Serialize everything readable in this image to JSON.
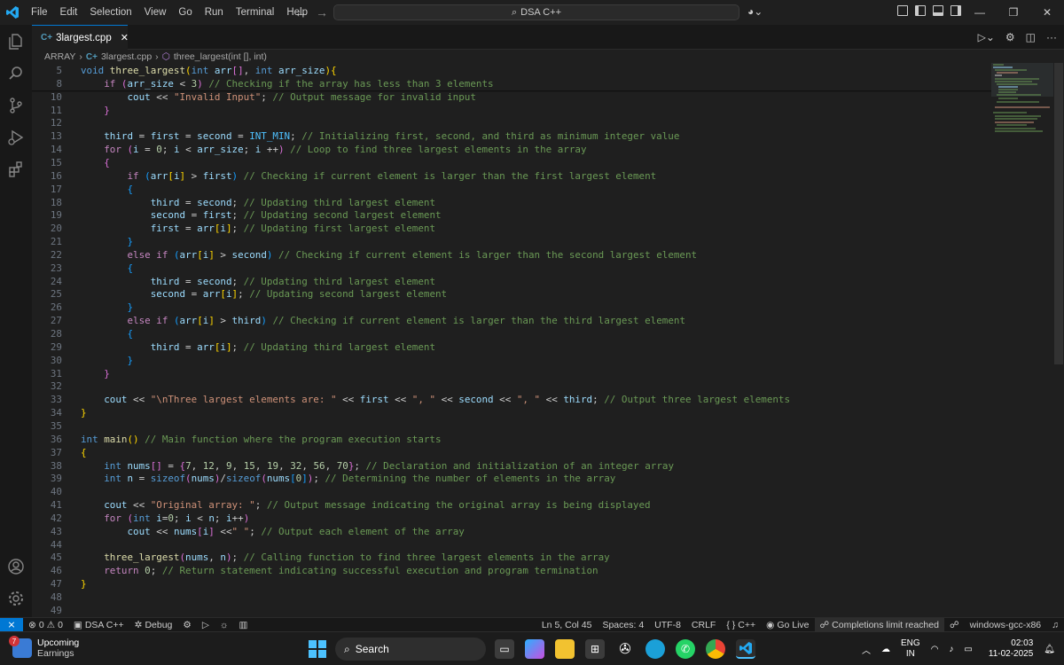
{
  "menu": [
    "File",
    "Edit",
    "Selection",
    "View",
    "Go",
    "Run",
    "Terminal",
    "Help"
  ],
  "command_center": {
    "label": "DSA C++"
  },
  "tab": {
    "label": "3largest.cpp",
    "close": "✕"
  },
  "breadcrumb": {
    "folder": "ARRAY",
    "file": "3largest.cpp",
    "symbol": "three_largest(int [], int)"
  },
  "code_lines": [
    {
      "ln": "5",
      "html": "<span class='k'>void</span> <span class='f'>three_largest</span><span class='b1'>(</span><span class='k'>int</span> <span class='v'>arr</span><span class='b2'>[]</span>, <span class='k'>int</span> <span class='v'>arr_size</span><span class='b1'>){</span>",
      "sticky": true
    },
    {
      "ln": "8",
      "html": "    <span class='kc'>if</span> <span class='b2'>(</span><span class='v'>arr_size</span> &lt; <span class='n'>3</span><span class='b2'>)</span> <span class='c'>// Checking if the array has less than 3 elements</span>",
      "sticky": true
    },
    {
      "ln": "10",
      "html": "        <span class='v'>cout</span> &lt;&lt; <span class='s'>\"Invalid Input\"</span>; <span class='c'>// Output message for invalid input</span>"
    },
    {
      "ln": "11",
      "html": "    <span class='b2'>}</span>"
    },
    {
      "ln": "12",
      "html": ""
    },
    {
      "ln": "13",
      "html": "    <span class='v'>third</span> = <span class='v'>first</span> = <span class='v'>second</span> = <span class='mac'>INT_MIN</span>; <span class='c'>// Initializing first, second, and third as minimum integer value</span>"
    },
    {
      "ln": "14",
      "html": "    <span class='kc'>for</span> <span class='b2'>(</span><span class='v'>i</span> = <span class='n'>0</span>; <span class='v'>i</span> &lt; <span class='v'>arr_size</span>; <span class='v'>i</span> ++<span class='b2'>)</span> <span class='c'>// Loop to find three largest elements in the array</span>"
    },
    {
      "ln": "15",
      "html": "    <span class='b2'>{</span>"
    },
    {
      "ln": "16",
      "html": "        <span class='kc'>if</span> <span class='b3'>(</span><span class='v'>arr</span><span class='b1'>[</span><span class='v'>i</span><span class='b1'>]</span> &gt; <span class='v'>first</span><span class='b3'>)</span> <span class='c'>// Checking if current element is larger than the first largest element</span>"
    },
    {
      "ln": "17",
      "html": "        <span class='b3'>{</span>"
    },
    {
      "ln": "18",
      "html": "            <span class='v'>third</span> = <span class='v'>second</span>; <span class='c'>// Updating third largest element</span>"
    },
    {
      "ln": "19",
      "html": "            <span class='v'>second</span> = <span class='v'>first</span>; <span class='c'>// Updating second largest element</span>"
    },
    {
      "ln": "20",
      "html": "            <span class='v'>first</span> = <span class='v'>arr</span><span class='b1'>[</span><span class='v'>i</span><span class='b1'>]</span>; <span class='c'>// Updating first largest element</span>"
    },
    {
      "ln": "21",
      "html": "        <span class='b3'>}</span>"
    },
    {
      "ln": "22",
      "html": "        <span class='kc'>else</span> <span class='kc'>if</span> <span class='b3'>(</span><span class='v'>arr</span><span class='b1'>[</span><span class='v'>i</span><span class='b1'>]</span> &gt; <span class='v'>second</span><span class='b3'>)</span> <span class='c'>// Checking if current element is larger than the second largest element</span>"
    },
    {
      "ln": "23",
      "html": "        <span class='b3'>{</span>"
    },
    {
      "ln": "24",
      "html": "            <span class='v'>third</span> = <span class='v'>second</span>; <span class='c'>// Updating third largest element</span>"
    },
    {
      "ln": "25",
      "html": "            <span class='v'>second</span> = <span class='v'>arr</span><span class='b1'>[</span><span class='v'>i</span><span class='b1'>]</span>; <span class='c'>// Updating second largest element</span>"
    },
    {
      "ln": "26",
      "html": "        <span class='b3'>}</span>"
    },
    {
      "ln": "27",
      "html": "        <span class='kc'>else</span> <span class='kc'>if</span> <span class='b3'>(</span><span class='v'>arr</span><span class='b1'>[</span><span class='v'>i</span><span class='b1'>]</span> &gt; <span class='v'>third</span><span class='b3'>)</span> <span class='c'>// Checking if current element is larger than the third largest element</span>"
    },
    {
      "ln": "28",
      "html": "        <span class='b3'>{</span>"
    },
    {
      "ln": "29",
      "html": "            <span class='v'>third</span> = <span class='v'>arr</span><span class='b1'>[</span><span class='v'>i</span><span class='b1'>]</span>; <span class='c'>// Updating third largest element</span>"
    },
    {
      "ln": "30",
      "html": "        <span class='b3'>}</span>"
    },
    {
      "ln": "31",
      "html": "    <span class='b2'>}</span>"
    },
    {
      "ln": "32",
      "html": ""
    },
    {
      "ln": "33",
      "html": "    <span class='v'>cout</span> &lt;&lt; <span class='s'>\"\\nThree largest elements are: \"</span> &lt;&lt; <span class='v'>first</span> &lt;&lt; <span class='s'>\", \"</span> &lt;&lt; <span class='v'>second</span> &lt;&lt; <span class='s'>\", \"</span> &lt;&lt; <span class='v'>third</span>; <span class='c'>// Output three largest elements</span>"
    },
    {
      "ln": "34",
      "html": "<span class='b1'>}</span>"
    },
    {
      "ln": "35",
      "html": ""
    },
    {
      "ln": "36",
      "html": "<span class='k'>int</span> <span class='f'>main</span><span class='b1'>()</span> <span class='c'>// Main function where the program execution starts</span>"
    },
    {
      "ln": "37",
      "html": "<span class='b1'>{</span>"
    },
    {
      "ln": "38",
      "html": "    <span class='k'>int</span> <span class='v'>nums</span><span class='b2'>[]</span> = <span class='b2'>{</span><span class='n'>7</span>, <span class='n'>12</span>, <span class='n'>9</span>, <span class='n'>15</span>, <span class='n'>19</span>, <span class='n'>32</span>, <span class='n'>56</span>, <span class='n'>70</span><span class='b2'>}</span>; <span class='c'>// Declaration and initialization of an integer array</span>"
    },
    {
      "ln": "39",
      "html": "    <span class='k'>int</span> <span class='v'>n</span> = <span class='k'>sizeof</span><span class='b2'>(</span><span class='v'>nums</span><span class='b2'>)</span>/<span class='k'>sizeof</span><span class='b2'>(</span><span class='v'>nums</span><span class='b3'>[</span><span class='n'>0</span><span class='b3'>]</span><span class='b2'>)</span>; <span class='c'>// Determining the number of elements in the array</span>"
    },
    {
      "ln": "40",
      "html": ""
    },
    {
      "ln": "41",
      "html": "    <span class='v'>cout</span> &lt;&lt; <span class='s'>\"Original array: \"</span>; <span class='c'>// Output message indicating the original array is being displayed</span>"
    },
    {
      "ln": "42",
      "html": "    <span class='kc'>for</span> <span class='b2'>(</span><span class='k'>int</span> <span class='v'>i</span>=<span class='n'>0</span>; <span class='v'>i</span> &lt; <span class='v'>n</span>; <span class='v'>i</span>++<span class='b2'>)</span>"
    },
    {
      "ln": "43",
      "html": "        <span class='v'>cout</span> &lt;&lt; <span class='v'>nums</span><span class='b2'>[</span><span class='v'>i</span><span class='b2'>]</span> &lt;&lt;<span class='s'>\" \"</span>; <span class='c'>// Output each element of the array</span>"
    },
    {
      "ln": "44",
      "html": ""
    },
    {
      "ln": "45",
      "html": "    <span class='f'>three_largest</span><span class='b2'>(</span><span class='v'>nums</span>, <span class='v'>n</span><span class='b2'>)</span>; <span class='c'>// Calling function to find three largest elements in the array</span>"
    },
    {
      "ln": "46",
      "html": "    <span class='kc'>return</span> <span class='n'>0</span>; <span class='c'>// Return statement indicating successful execution and program termination</span>"
    },
    {
      "ln": "47",
      "html": "<span class='b1'>}</span>"
    },
    {
      "ln": "48",
      "html": ""
    },
    {
      "ln": "49",
      "html": ""
    }
  ],
  "statusbar": {
    "errors": "0",
    "warnings": "0",
    "workspace": "DSA C++",
    "debug": "Debug",
    "position": "Ln 5, Col 45",
    "spaces": "Spaces: 4",
    "encoding": "UTF-8",
    "eol": "CRLF",
    "language": "C++",
    "golive": "Go Live",
    "completions": "Completions limit reached",
    "config": "windows-gcc-x86"
  },
  "taskbar": {
    "weather_title": "Upcoming",
    "weather_sub": "Earnings",
    "weather_badge": "7",
    "search": "Search",
    "lang_top": "ENG",
    "lang_bottom": "IN",
    "time": "02:03",
    "date": "11-02-2025"
  },
  "icons": {
    "explorer": "explorer-icon",
    "search": "search-icon",
    "scm": "source-control-icon",
    "debug": "run-debug-icon",
    "extensions": "extensions-icon",
    "account": "account-icon",
    "settings": "gear-icon"
  }
}
